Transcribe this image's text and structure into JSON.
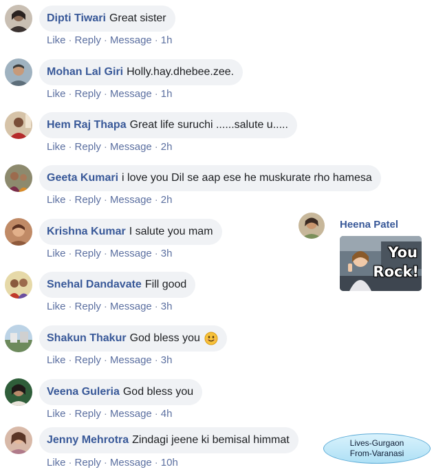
{
  "actions": {
    "like": "Like",
    "reply": "Reply",
    "message": "Message"
  },
  "comments": [
    {
      "name": "Dipti Tiwari",
      "text": "Great sister",
      "time": "1h"
    },
    {
      "name": "Mohan Lal Giri",
      "text": "Holly.hay.dhebee.zee.",
      "time": "1h"
    },
    {
      "name": "Hem Raj Thapa",
      "text": "Great life suruchi ......salute u.....",
      "time": "2h"
    },
    {
      "name": "Geeta Kumari",
      "text": "i love you Dil se aap ese he muskurate rho hamesa",
      "time": "2h"
    },
    {
      "name": "Krishna Kumar",
      "text": "I salute you mam",
      "time": "3h"
    },
    {
      "name": "Snehal Dandavate",
      "text": "Fill good",
      "time": "3h"
    },
    {
      "name": "Shakun Thakur",
      "text": "God bless you",
      "time": "3h",
      "emoji": "smiling-face"
    },
    {
      "name": "Veena Guleria",
      "text": "God bless you",
      "time": "4h"
    },
    {
      "name": "Jenny Mehrotra",
      "text": "Zindagi jeene ki bemisal himmat",
      "time": "10h"
    }
  ],
  "side_reply": {
    "name": "Heena Patel",
    "sticker_line1": "You",
    "sticker_line2": "Rock!"
  },
  "callout": {
    "line1": "Lives-Gurgaon",
    "line2": "From-Varanasi"
  },
  "colors": {
    "name": "#385898",
    "bubble": "#f0f2f5",
    "link": "#5b6fa0"
  }
}
